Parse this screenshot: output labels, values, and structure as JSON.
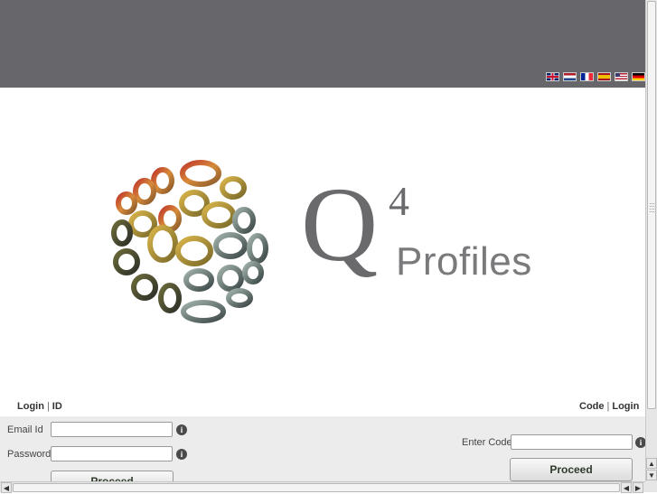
{
  "header": {
    "languages": [
      {
        "code": "en-GB",
        "icon": "uk-flag-icon"
      },
      {
        "code": "nl",
        "icon": "netherlands-flag-icon"
      },
      {
        "code": "fr",
        "icon": "france-flag-icon"
      },
      {
        "code": "es",
        "icon": "spain-flag-icon"
      },
      {
        "code": "en-US",
        "icon": "us-flag-icon"
      },
      {
        "code": "de",
        "icon": "germany-flag-icon"
      }
    ]
  },
  "brand": {
    "letter": "Q",
    "superscript": "4",
    "word": "Profiles",
    "logo_icon": "q-sphere-logo-icon"
  },
  "left_panel": {
    "tab_login": "Login",
    "tab_id": "ID",
    "separator": "|",
    "email_label": "Email Id",
    "email_value": "",
    "password_label": "Password",
    "password_value": "",
    "info_glyph": "i",
    "proceed": "Proceed"
  },
  "right_panel": {
    "tab_code": "Code",
    "tab_login": "Login",
    "separator": "|",
    "code_label": "Enter Code",
    "code_value": "",
    "info_glyph": "i",
    "proceed": "Proceed"
  },
  "colors": {
    "header_bg": "#67666b",
    "brand_gray": "#6a6a6d",
    "form_band": "#ececec"
  },
  "scrollbars": {
    "up": "▲",
    "down": "▼",
    "left": "◀",
    "right": "▶"
  }
}
